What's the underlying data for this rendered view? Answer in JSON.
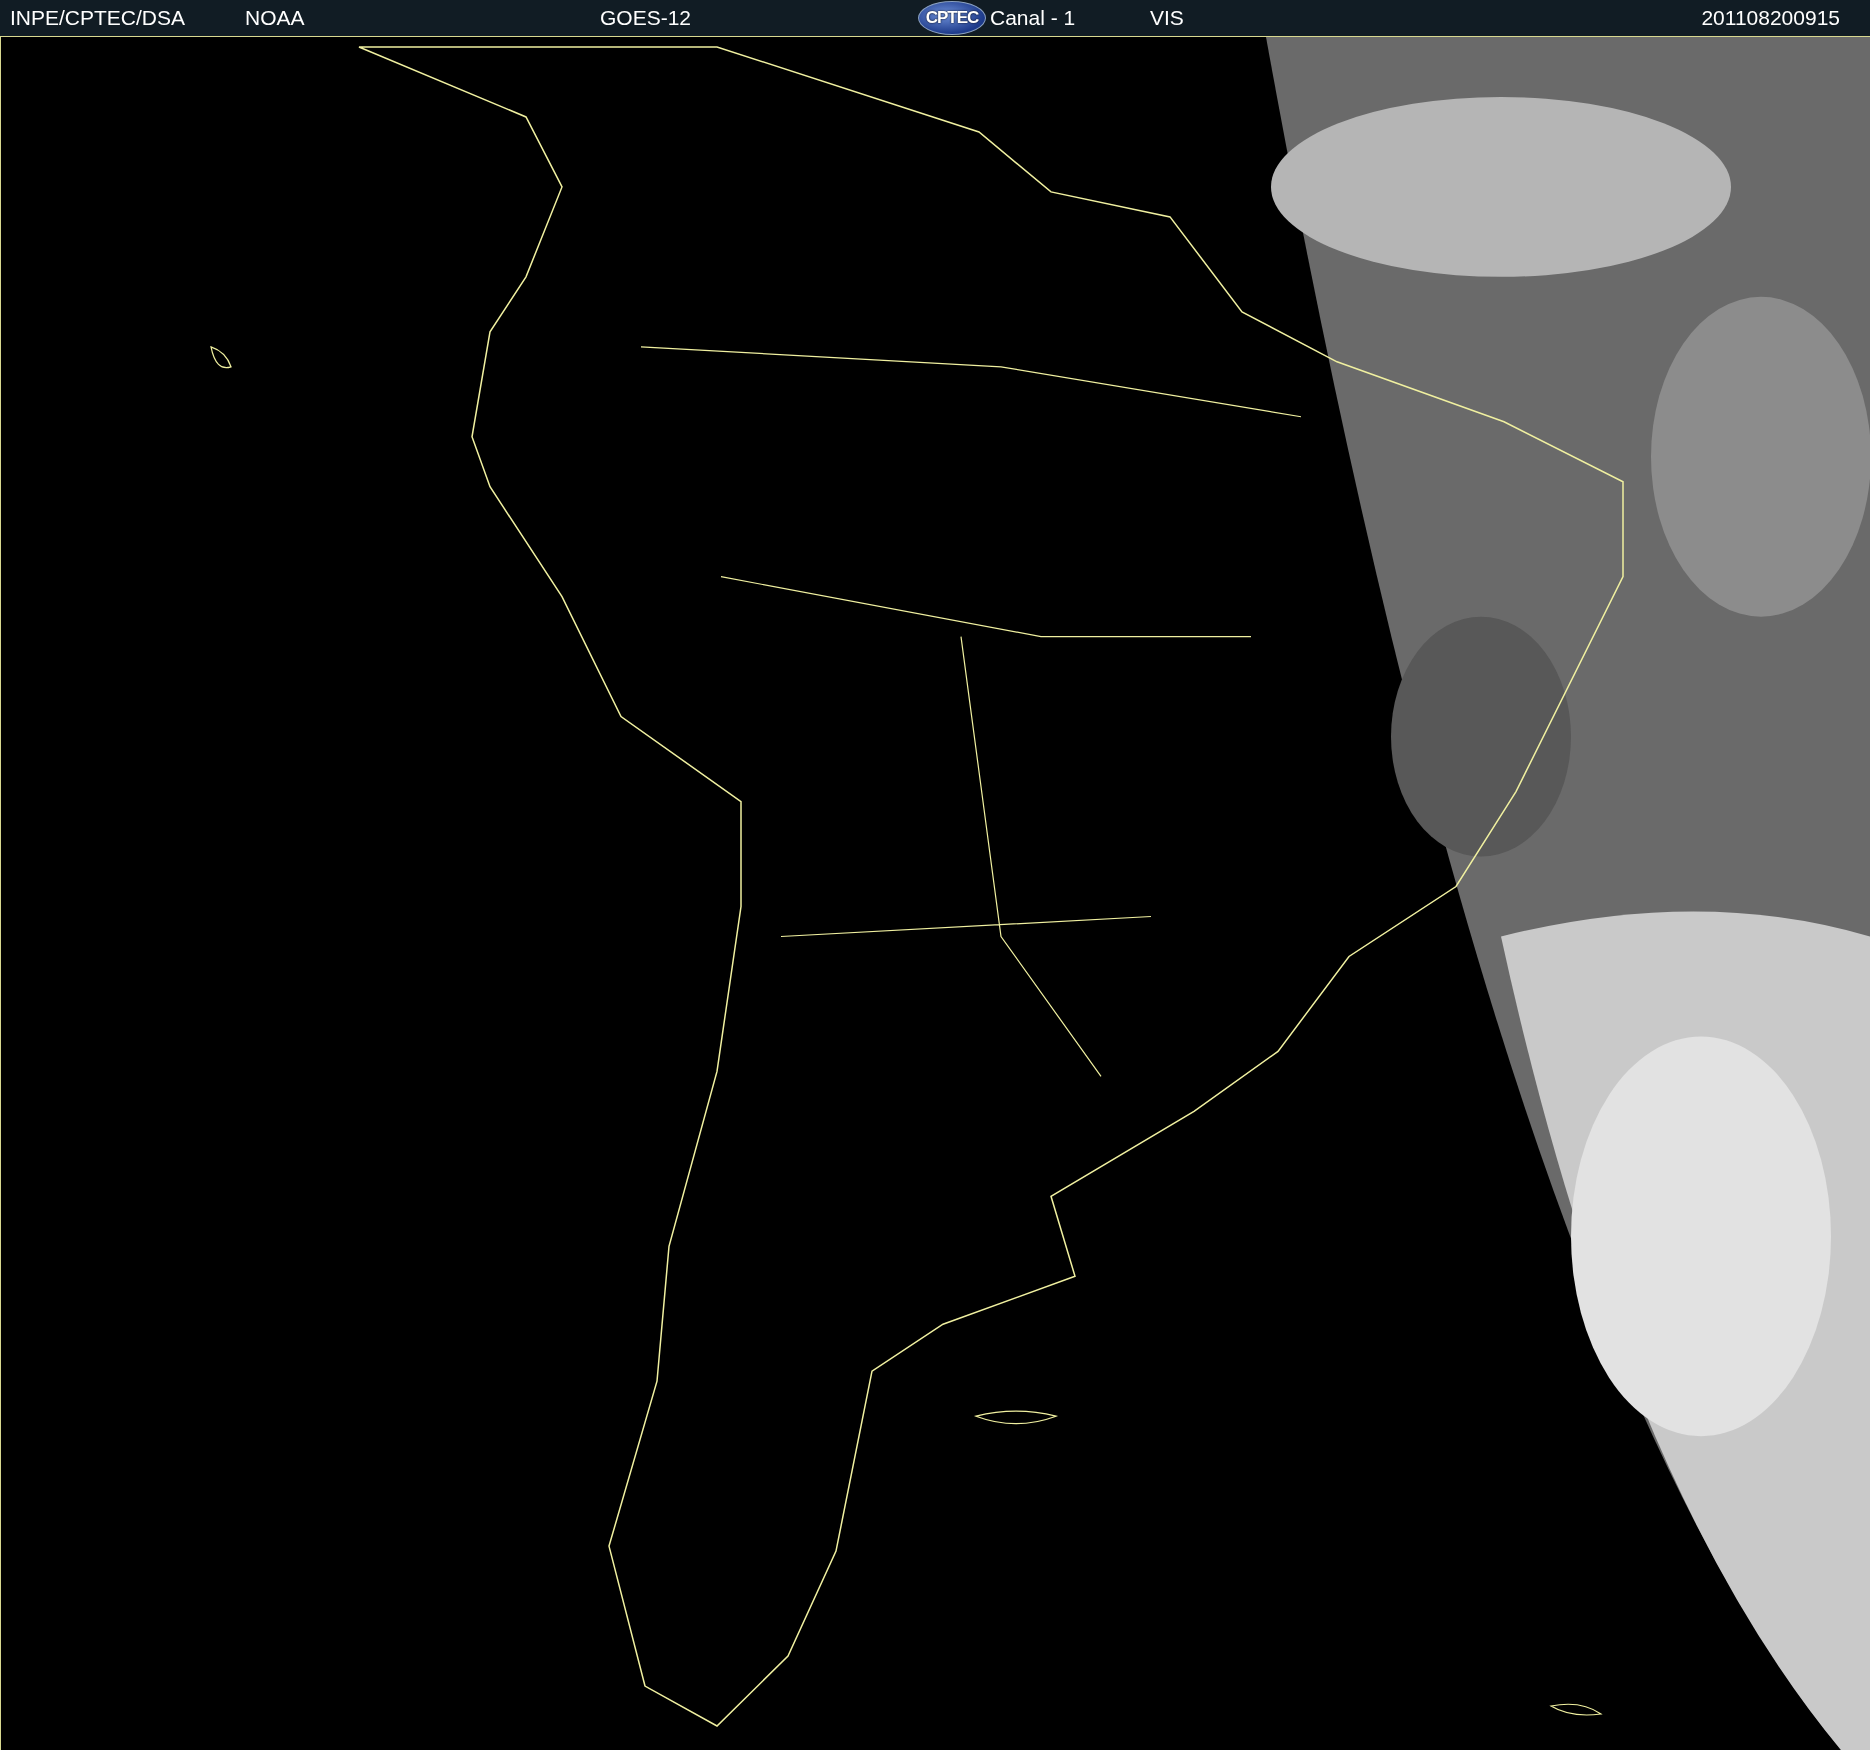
{
  "header": [
    {
      "kind": "text",
      "text": "INPE/CPTEC/DSA"
    },
    {
      "kind": "text",
      "text": "NOAA"
    },
    {
      "kind": "text",
      "text": "GOES-12"
    },
    {
      "kind": "logo",
      "text": "CPTEC"
    },
    {
      "kind": "text",
      "text": "Canal - 1"
    },
    {
      "kind": "text",
      "text": "VIS"
    },
    {
      "kind": "text",
      "text": "201108200915"
    }
  ]
}
